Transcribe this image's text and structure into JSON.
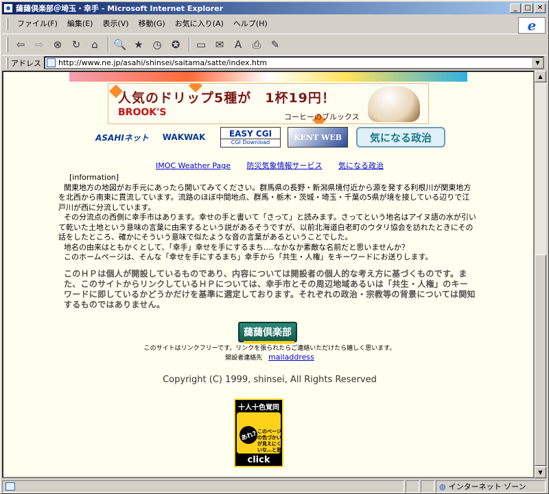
{
  "window": {
    "title": "藹藹倶楽部＠埼玉・幸手 - Microsoft Internet Explorer",
    "minimize": "_",
    "maximize": "□",
    "close": "✕"
  },
  "menubar": {
    "items": [
      "ファイル(F)",
      "編集(E)",
      "表示(V)",
      "移動(G)",
      "お気に入り(A)",
      "ヘルプ(H)"
    ]
  },
  "toolbar": {
    "buttons": [
      "back-icon",
      "forward-icon",
      "stop-icon",
      "refresh-icon",
      "home-icon",
      "search-icon",
      "favorites-icon",
      "history-icon",
      "channels-icon",
      "fullscreen-icon",
      "mail-icon",
      "font-icon",
      "print-icon",
      "edit-icon"
    ]
  },
  "address": {
    "label": "アドレス",
    "url": "http://www.ne.jp/asahi/shinsei/saitama/satte/index.htm"
  },
  "banners": {
    "drip_main": "人気のドリップ5種が　1杯19円！",
    "drip_brand": "BROOK'S",
    "drip_sub": "コーヒーのブルックス"
  },
  "logos": {
    "asahi": "ASAHIネット",
    "wakwak": "WAKWAK",
    "easycgi": "EASY CGI",
    "easycgi_sub": "CGI Download",
    "kentweb": "KENT WEB",
    "kininaru": "気になる政治"
  },
  "links": [
    "IMOC Weather Page",
    "防災気象情報サービス",
    "気になる政治"
  ],
  "info": {
    "heading": "[information]",
    "p1": "関東地方の地図がお手元にあったら開いてみてください。群馬県の長野・新潟県境付近から源を発する利根川が関東地方を北西から南東に貫流しています。流路のほぼ中間地点、群馬・栃木・茨城・埼玉・千葉の5県が境を接している辺りで江戸川が西に分流しています。",
    "p2": "その分流点の西側に幸手市はあります。幸せの手と書いて「さって」と読みます。さってという地名はアイヌ語の水が引いて乾いた土地という意味の言葉に由来するという説があるそうですが、以前北海道白老町のウタリ協会を訪れたときにその話をしたところ、確かにそういう意味で似たような音の言葉があるということでした。",
    "p3": "地名の由来はともかくとして、「幸手」幸せを手にするまち….なかなか素敵な名前だと思いませんか？",
    "p4": "このホームページは、そんな「幸せを手にするまち」幸手から「共生・人権」をキーワードにお送りします。"
  },
  "disclaimer": "このＨＰは個人が開設しているものであり、内容については開設者の個人的な考え方に基づくものです。また、このサイトからリンクしているＨＰについては、幸手市とその周辺地域あるいは「共生・人権」のキーワードに即しているかどうかだけを基準に選定しております。それぞれの政治・宗教等の背景については関知するものではありません。",
  "club_badge": "藹藹倶楽部",
  "linkfree": "このサイトはリンクフリーです。リンクを張られたらご連絡いただけたら嬉しく思います。",
  "mail_label": "開設者連絡先",
  "mail_link": "mailaddress",
  "copyright": "Copyright (C) 1999, shinsei, All Rights Reserved",
  "click_badge": {
    "top": "十人十色覚同盟",
    "bubble": "あれ?",
    "question": "このページの色づかいが見えにくいな…と思ったら",
    "click": "click"
  },
  "status": {
    "zone": "インターネット ゾーン"
  }
}
